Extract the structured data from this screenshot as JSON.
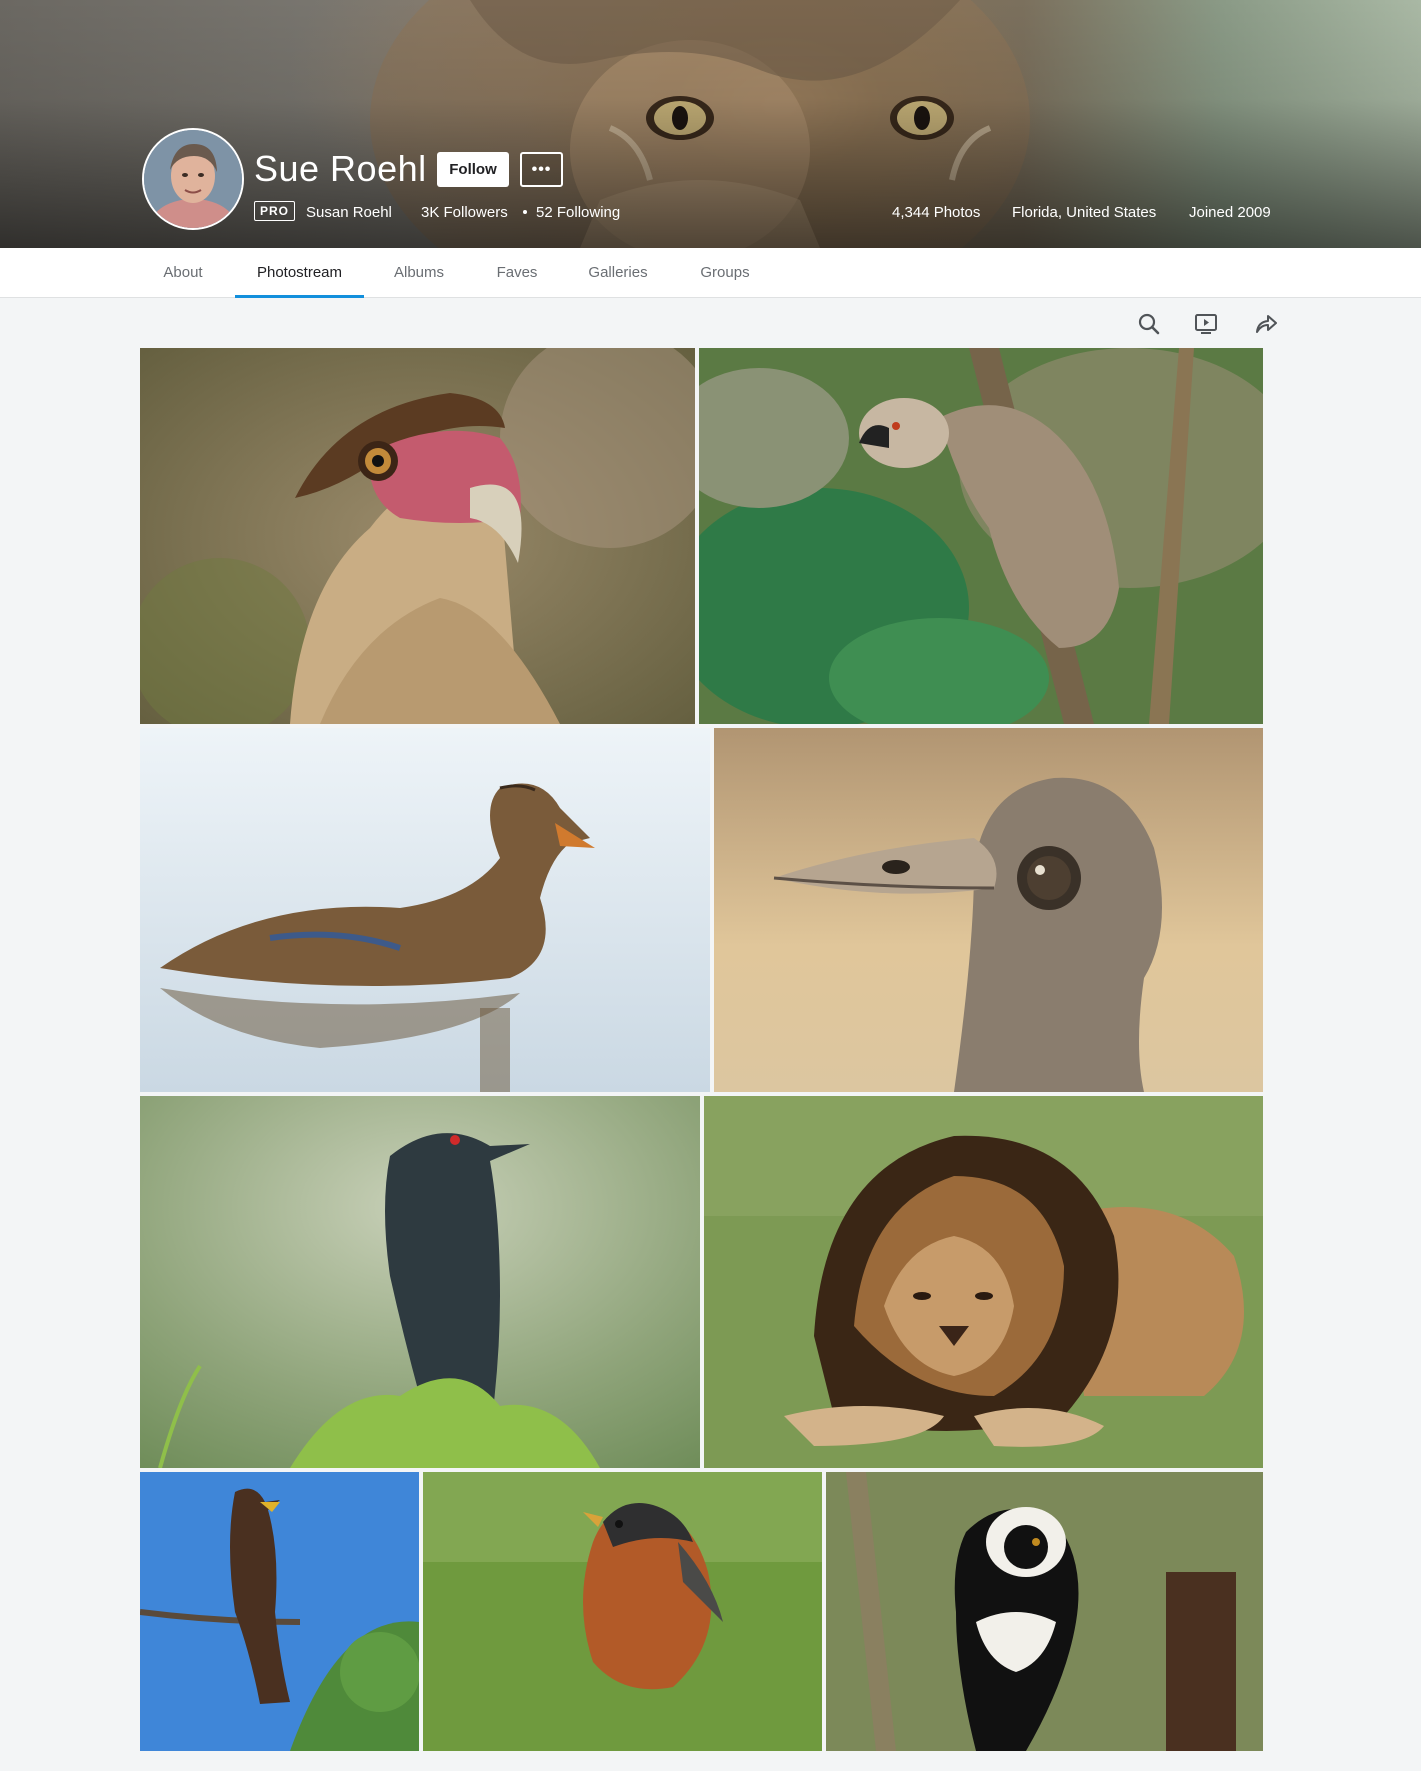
{
  "profile": {
    "display_name": "Sue Roehl",
    "pro_label": "PRO",
    "real_name": "Susan Roehl",
    "followers": "3K Followers",
    "following": "52 Following",
    "photos_count": "4,344 Photos",
    "location": "Florida, United States",
    "joined": "Joined 2009",
    "follow_label": "Follow",
    "more_label": "•••"
  },
  "nav": {
    "tabs": [
      {
        "label": "About"
      },
      {
        "label": "Photostream"
      },
      {
        "label": "Albums"
      },
      {
        "label": "Faves"
      },
      {
        "label": "Galleries"
      },
      {
        "label": "Groups"
      }
    ],
    "active_tab": "Photostream"
  },
  "toolbar": {
    "icons": [
      "search-icon",
      "slideshow-icon",
      "share-icon"
    ]
  },
  "photos": [
    {
      "subject": "caracara-bird"
    },
    {
      "subject": "brown-lemur"
    },
    {
      "subject": "mottled-duck"
    },
    {
      "subject": "ostrich"
    },
    {
      "subject": "drongo-bird"
    },
    {
      "subject": "male-lion"
    },
    {
      "subject": "black-kite"
    },
    {
      "subject": "american-robin"
    },
    {
      "subject": "ruffed-lemur"
    }
  ],
  "colors": {
    "accent": "#128fdc",
    "background": "#f3f5f6",
    "nav_text": "#6a6e73",
    "active_text": "#212124"
  }
}
